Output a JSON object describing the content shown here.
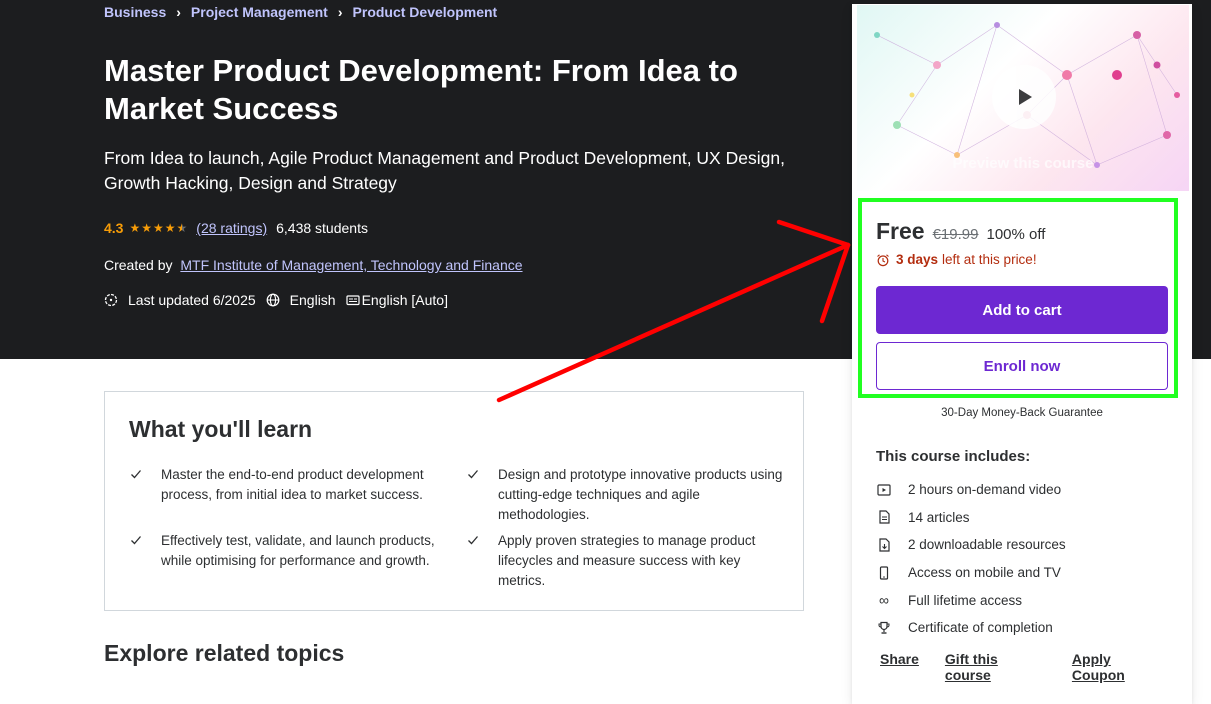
{
  "breadcrumb": [
    "Business",
    "Project Management",
    "Product Development"
  ],
  "course": {
    "title": "Master Product Development: From Idea to Market Success",
    "subtitle": "From Idea to launch, Agile Product Management and Product Development, UX Design, Growth Hacking, Design and Strategy",
    "rating": "4.3",
    "rating_value": 4.3,
    "ratings_count": "(28 ratings)",
    "students": "6,438 students",
    "created_by_label": "Created by",
    "author": "MTF Institute of Management, Technology and Finance",
    "last_updated": "Last updated 6/2025",
    "language": "English",
    "captions": "English [Auto]"
  },
  "sidebar": {
    "preview_label": "Preview this course",
    "price": "Free",
    "original_price": "€19.99",
    "discount": "100% off",
    "timer_days": "3 days",
    "timer_text": "left at this price!",
    "add_to_cart": "Add to cart",
    "enroll_now": "Enroll now",
    "guarantee": "30-Day Money-Back Guarantee",
    "includes_title": "This course includes:",
    "includes": [
      {
        "icon": "video-icon",
        "text": "2 hours on-demand video"
      },
      {
        "icon": "article-icon",
        "text": "14 articles"
      },
      {
        "icon": "download-icon",
        "text": "2 downloadable resources"
      },
      {
        "icon": "mobile-icon",
        "text": "Access on mobile and TV"
      },
      {
        "icon": "infinity-icon",
        "text": "Full lifetime access"
      },
      {
        "icon": "trophy-icon",
        "text": "Certificate of completion"
      }
    ],
    "links": [
      "Share",
      "Gift this course",
      "Apply Coupon"
    ]
  },
  "learn": {
    "title": "What you'll learn",
    "items": [
      "Master the end-to-end product development process, from initial idea to market success.",
      "Design and prototype innovative products using cutting-edge techniques and agile methodologies.",
      "Effectively test, validate, and launch products, while optimising for performance and growth.",
      "Apply proven strategies to manage product lifecycles and measure success with key metrics."
    ]
  },
  "related_title": "Explore related topics",
  "colors": {
    "hero_bg": "#1c1d1f",
    "accent_purple": "#6d28d2",
    "link_lavender": "#c0c4fc",
    "star_orange": "#f69c08",
    "timer_red": "#b32d0f",
    "highlight_green": "#21ff21",
    "annotation_red": "#ff0000"
  }
}
